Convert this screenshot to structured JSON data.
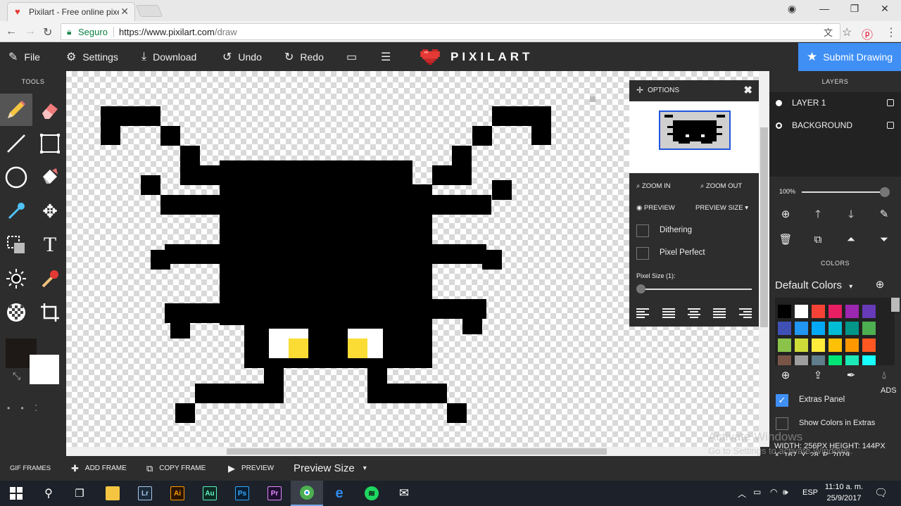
{
  "browser": {
    "tab_title": "Pixilart - Free online pixe",
    "secure_label": "Seguro",
    "url_host": "https://www.pixilart.com",
    "url_path": "/draw"
  },
  "toolbar": {
    "file_label": "File",
    "settings_label": "Settings",
    "download_label": "Download",
    "undo_label": "Undo",
    "redo_label": "Redo",
    "logo_text": "PIXILART",
    "submit_label": "Submit Drawing"
  },
  "tools": {
    "header": "TOOLS",
    "items": [
      "pencil",
      "eraser",
      "line",
      "rectangle",
      "circle",
      "fill-bucket",
      "eyedropper",
      "move",
      "selection",
      "text",
      "lighten",
      "dither-brush",
      "checker-pattern",
      "crop"
    ]
  },
  "options": {
    "title": "OPTIONS",
    "zoom_in": "ZOOM IN",
    "zoom_out": "ZOOM OUT",
    "preview": "PREVIEW",
    "preview_size": "PREVIEW SIZE",
    "dithering": "Dithering",
    "pixel_perfect": "Pixel Perfect",
    "pixel_size": "Pixel Size (1):"
  },
  "layers": {
    "header": "LAYERS",
    "items": [
      "LAYER 1",
      "BACKGROUND"
    ],
    "opacity": "100%"
  },
  "colors": {
    "header": "COLORS",
    "palette_name": "Default Colors",
    "swatches": [
      "#000000",
      "#ffffff",
      "#f44336",
      "#e91e63",
      "#9c27b0",
      "#673ab7",
      "#3f51b5",
      "#2196f3",
      "#03a9f4",
      "#00bcd4",
      "#009688",
      "#4caf50",
      "#8bc34a",
      "#cddc39",
      "#ffeb3b",
      "#ffc107",
      "#ff9800",
      "#ff5722",
      "#795548",
      "#9e9e9e",
      "#607d8b",
      "#00e676",
      "#1de9b6",
      "#18ffff"
    ],
    "ads_label": "ADS",
    "extras_panel": "Extras Panel",
    "show_colors": "Show Colors in Extras"
  },
  "status": {
    "dims": "WIDTH: 256PX HEIGHT: 144PX",
    "coords": "X: 167, Y: 28, P: 7079"
  },
  "frames": {
    "gif_frames": "GIF FRAMES",
    "add_frame": "ADD FRAME",
    "copy_frame": "COPY FRAME",
    "preview": "PREVIEW",
    "preview_size": "Preview Size"
  },
  "watermark": {
    "line1": "Activate Windows",
    "line2": "Go to Settings to activate Windows."
  },
  "taskbar": {
    "lang": "ESP",
    "time": "11:10 a. m.",
    "date": "25/9/2017"
  },
  "colors_theme": {
    "accent": "#3f8ff5",
    "panel": "#2d2d2d",
    "spider": "#000000",
    "eye_yellow": "#fbdc35"
  }
}
